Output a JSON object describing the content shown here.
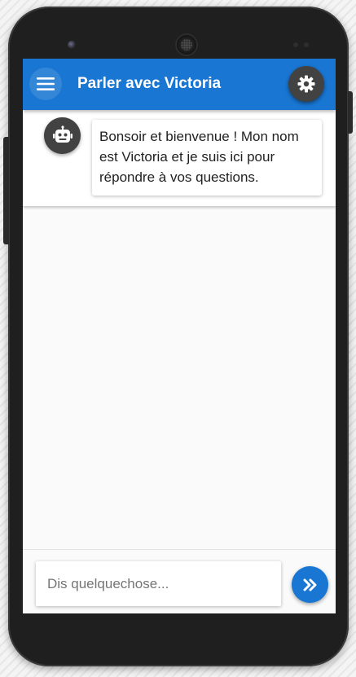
{
  "app": {
    "title": "Parler avec Victoria",
    "accent_color": "#1976d2",
    "dark_button_color": "#424242"
  },
  "header": {
    "menu_icon": "menu-icon",
    "settings_icon": "gear-icon"
  },
  "chat": {
    "messages": [
      {
        "sender": "bot",
        "avatar_icon": "robot-icon",
        "text": "Bonsoir et bienvenue ! Mon nom est Victoria et je suis ici pour répondre à vos questions."
      }
    ]
  },
  "composer": {
    "value": "",
    "placeholder": "Dis quelquechose...",
    "send_icon": "double-chevron-right-icon"
  }
}
